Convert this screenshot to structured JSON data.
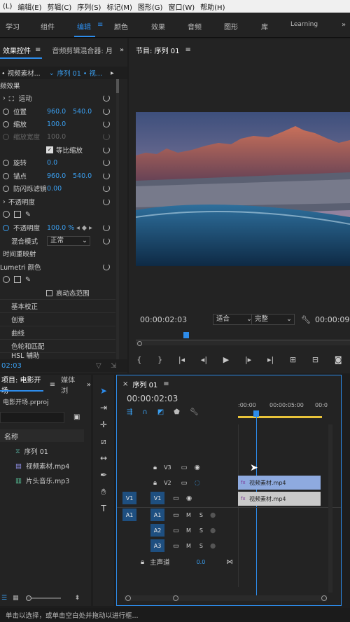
{
  "menu": [
    "(L)",
    "编辑(E)",
    "剪辑(C)",
    "序列(S)",
    "标记(M)",
    "图形(G)",
    "窗口(W)",
    "帮助(H)"
  ],
  "workspaces": [
    "学习",
    "组件",
    "编辑",
    "颜色",
    "效果",
    "音频",
    "图形",
    "库",
    "Learning"
  ],
  "effect_controls": {
    "tab": "效果控件",
    "tab2": "音频剪辑混合器: 月",
    "source": "• 视频素材...",
    "sequence": "序列 01 • 视...",
    "section_video": "频效果",
    "motion": "运动",
    "position_label": "位置",
    "position_x": "960.0",
    "position_y": "540.0",
    "scale_label": "缩放",
    "scale_value": "100.0",
    "scale_width_label": "缩放宽度",
    "scale_width_value": "100.0",
    "uniform_label": "等比缩放",
    "rotation_label": "旋转",
    "rotation_value": "0.0",
    "anchor_label": "锚点",
    "anchor_x": "960.0",
    "anchor_y": "540.0",
    "flicker_label": "防闪烁滤镜",
    "flicker_value": "0.00",
    "opacity_section": "不透明度",
    "opacity_label": "不透明度",
    "opacity_value": "100.0 %",
    "blend_label": "混合模式",
    "blend_value": "正常",
    "time_remap": "时间重映射",
    "lumetri": "Lumetri 颜色",
    "hdr_label": "高动态范围",
    "basic": "基本校正",
    "creative": "创意",
    "curves": "曲线",
    "wheels": "色轮和匹配",
    "hsl": "HSL 辅助",
    "timecode": "02:03"
  },
  "program": {
    "title": "节目: 序列 01",
    "timecode": "00:00:02:03",
    "fit": "适合",
    "quality": "完整",
    "duration": "00:00:09:0"
  },
  "project": {
    "tab": "项目: 电影开场",
    "tab2": "媒体浏",
    "file": "电影开场.prproj",
    "column": "名称",
    "items": [
      "序列 01",
      "视频素材.mp4",
      "片头音乐.mp3"
    ]
  },
  "timeline": {
    "tab": "序列 01",
    "timecode": "00:00:02:03",
    "ruler": [
      ":00:00",
      "00:00:05:00",
      "00:0"
    ],
    "tracks_video": [
      "V3",
      "V2",
      "V1"
    ],
    "tracks_audio": [
      "A1",
      "A2",
      "A3"
    ],
    "master": "主声道",
    "master_value": "0.0",
    "clip_v2": "视频素材.mp4",
    "clip_v1": "视频素材.mp4",
    "src_v": "V1",
    "src_a": "A1",
    "m": "M",
    "s": "S"
  },
  "status": "单击以选择，或单击空白处并拖动以进行框...",
  "colors": {
    "accent": "#2d8ceb",
    "clip_v2": "#8eaadf",
    "clip_v1": "#c9c9c9"
  }
}
